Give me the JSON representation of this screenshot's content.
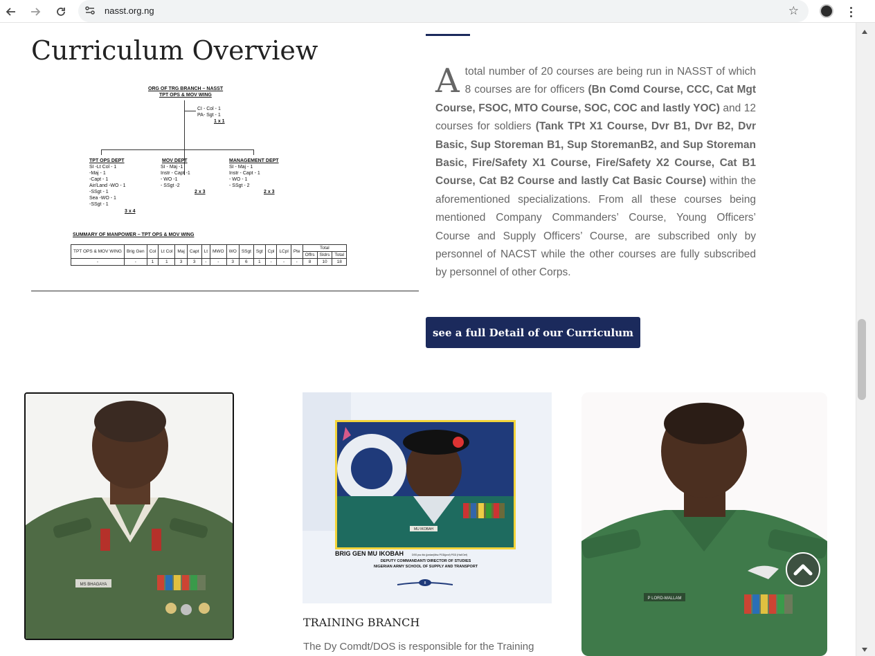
{
  "browser": {
    "url": "nasst.org.ng",
    "icons": [
      "back-arrow-icon",
      "forward-arrow-icon",
      "reload-icon",
      "site-info-icon",
      "bookmark-star-icon",
      "profile-avatar",
      "menu-kebab-icon"
    ]
  },
  "section": {
    "title": "Curriculum Overview",
    "drop_cap": "A",
    "paragraph_intro": "total number of 20 courses are being run in NASST of which 8 courses are for officers ",
    "officer_courses": "(Bn Comd Course, CCC, Cat Mgt Course, FSOC, MTO Course, SOC, COC and lastly YOC)",
    "paragraph_mid": " and 12 courses for soldiers ",
    "soldier_courses": "(Tank TPt X1 Course, Dvr B1, Dvr B2, Dvr Basic, Sup Storeman B1, Sup StoremanB2, and Sup Storeman Basic, Fire/Safety X1 Course, Fire/Safety X2 Course, Cat B1 Course, Cat B2 Course and lastly Cat Basic Course)",
    "paragraph_end": " within the aforementioned specializations. From all these courses being mentioned Company Commanders’ Course, Young Officers’ Course and Supply Officers’ Course, are subscribed only by personnel of NACST while the other courses are fully subscribed by personnel of other Corps.",
    "cta_label": "see a full Detail of our Curriculum"
  },
  "org_chart": {
    "heading_1": "ORG OF TRG BRANCH – NASST",
    "heading_2": "TPT OPS & MOV WING",
    "ci": "CI -  Col - 1",
    "pa": "PA-  Sgt - 1",
    "top_total": "1 x 1",
    "tpt_ops": {
      "title": "TPT OPS DEPT",
      "lines": [
        "SI         -Lt Col -  1",
        "              -Maj    -  1",
        "              -Capt   -  1",
        "Air/Land -WO     -  1",
        "              -SSgt  -  1",
        "Sea        -WO    -  1",
        "              -SSgt  -  1"
      ],
      "total": "3 x 4"
    },
    "mov": {
      "title": "MOV DEPT",
      "lines": [
        "SI      - Maj   -1",
        "Instr   - Capt  -1",
        "           - WO   -1",
        "           - SSgt  -2"
      ],
      "total": "2 x 3"
    },
    "mgt": {
      "title": "MANAGEMENT DEPT",
      "lines": [
        "SI      - Maj  - 1",
        "Instr   - Capt - 1",
        "           - WO  - 1",
        "           - SSgt - 2"
      ],
      "total": "2 x 3"
    },
    "summary_title": "SUMMARY OF MANPOWER – TPT OPS & MOV WING",
    "table_headers": [
      "TPT OPS & MOV WING",
      "Brig Gen",
      "Col",
      "Lt Col",
      "Maj",
      "Capt",
      "Lt",
      "MWO",
      "WO",
      "SSgt",
      "Sgt",
      "Cpl",
      "LCpl",
      "Pte",
      "Total"
    ],
    "total_sub": [
      "Offrs",
      "Sldrs",
      "Total"
    ],
    "table_values": [
      "-",
      "1",
      "1",
      "3",
      "3",
      "-",
      "-",
      "3",
      "6",
      "1",
      "-",
      "-",
      "-",
      "8",
      "10",
      "18"
    ]
  },
  "photos": {
    "photo1_nametag": "MS BHAGAYA",
    "photo2_caption_name": "BRIG GEN MU IKOBAH",
    "photo2_caption_suffix": "DSS psc fdc (jordan)Msc PGD(prof) PGD (Hall Def)",
    "photo2_caption_role": "DEPUTY COMMANDANT/ DIRECTOR OF STUDIES",
    "photo2_caption_school": "NIGERIAN ARMY SCHOOL  OF SUPPLY AND TRANSPORT",
    "photo2_nametag": "MU IKOBAH",
    "photo2_page": "8",
    "photo3_nametag": "P LORD-MALLAM"
  },
  "training_branch": {
    "title": "TRAINING BRANCH",
    "text": "The Dy Comdt/DOS is responsible for the Training"
  },
  "colors": {
    "accent_navy": "#1b2a5c",
    "body_text": "#666666"
  }
}
